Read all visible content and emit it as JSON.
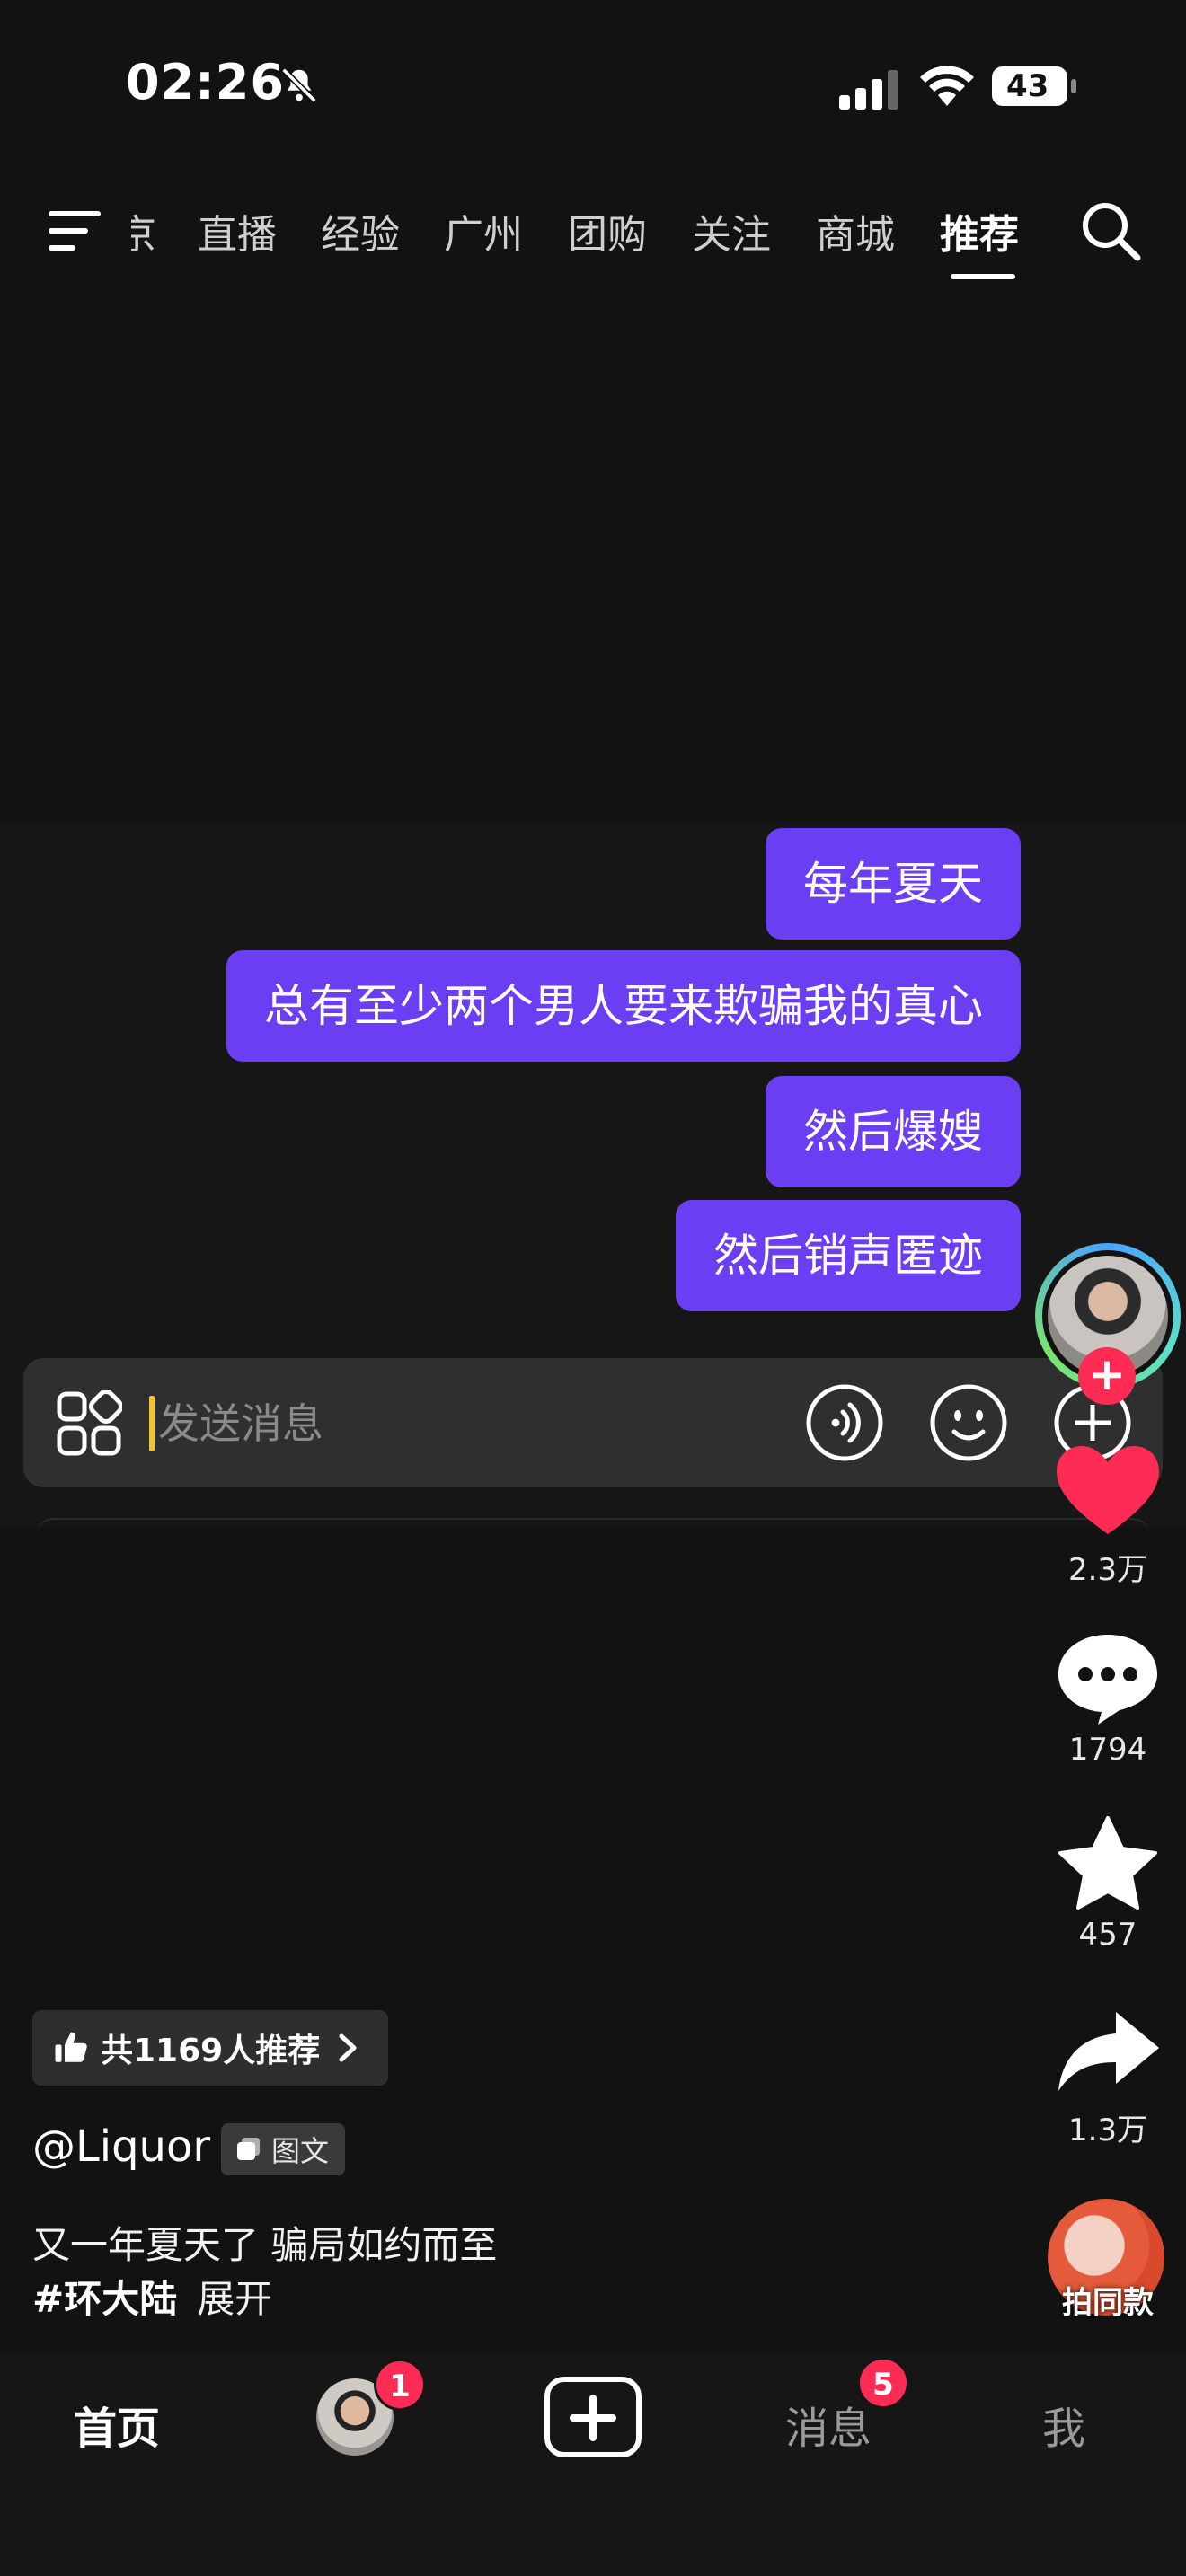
{
  "status_bar": {
    "time": "02:26",
    "battery": "43"
  },
  "top_tabs": {
    "partial": "京",
    "items": [
      "直播",
      "经验",
      "广州",
      "团购",
      "关注",
      "商城",
      "推荐"
    ],
    "active": "推荐"
  },
  "bubbles": [
    "每年夏天",
    "总有至少两个男人要来欺骗我的真心",
    "然后爆嫂",
    "然后销声匿迹"
  ],
  "message_bar": {
    "placeholder": "发送消息"
  },
  "right_rail": {
    "likes": "2.3万",
    "comments": "1794",
    "favorites": "457",
    "shares": "1.3万",
    "same_style": "拍同款"
  },
  "post": {
    "recommend": "共1169人推荐",
    "author": "@Liquor",
    "type_badge": "图文",
    "caption": "又一年夏天了 骗局如约而至",
    "hashtag": "#环大陆",
    "expand": "展开"
  },
  "bottom_nav": {
    "home": "首页",
    "friends_badge": "1",
    "messages": "消息",
    "messages_badge": "5",
    "me": "我"
  },
  "colors": {
    "accent": "#6c3ef3",
    "like": "#fe2c55",
    "background": "#121212"
  }
}
